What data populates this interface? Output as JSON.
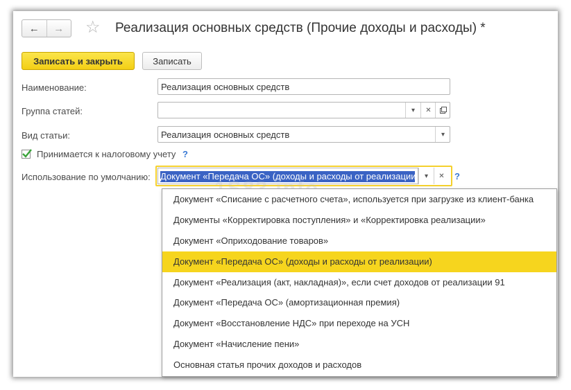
{
  "window": {
    "title": "Реализация основных средств (Прочие доходы и расходы) *",
    "back_icon": "arrow-left-icon",
    "forward_icon": "arrow-right-icon",
    "favorite_icon": "star-icon"
  },
  "toolbar": {
    "save_close_label": "Записать и закрыть",
    "save_label": "Записать"
  },
  "form": {
    "name_label": "Наименование:",
    "name_value": "Реализация основных средств",
    "group_label": "Группа статей:",
    "group_value": "",
    "type_label": "Вид статьи:",
    "type_value": "Реализация основных средств",
    "tax_label": "Принимается к налоговому учету",
    "tax_checked": true,
    "help_mark": "?",
    "default_label": "Использование по умолчанию:",
    "default_value": "Документ «Передача ОС» (доходы и расходы от реализации)"
  },
  "dropdown": {
    "options": [
      "Документ «Списание с расчетного счета», используется при загрузке из клиент-банка",
      "Документы «Корректировка поступления» и «Корректировка реализации»",
      "Документ «Оприходование товаров»",
      "Документ «Передача ОС» (доходы и расходы от реализации)",
      "Документ «Реализация (акт, накладная)», если счет доходов от реализации 91",
      "Документ «Передача ОС» (амортизационная премия)",
      "Документ «Восстановление НДС» при переходе на УСН",
      "Документ «Начисление пени»",
      "Основная статья прочих доходов и расходов"
    ],
    "selected_index": 3
  },
  "watermark": "1S83.info",
  "colors": {
    "accent_yellow": "#f6d51e",
    "selection_blue": "#3a63c4",
    "help_blue": "#3a7ad5"
  }
}
